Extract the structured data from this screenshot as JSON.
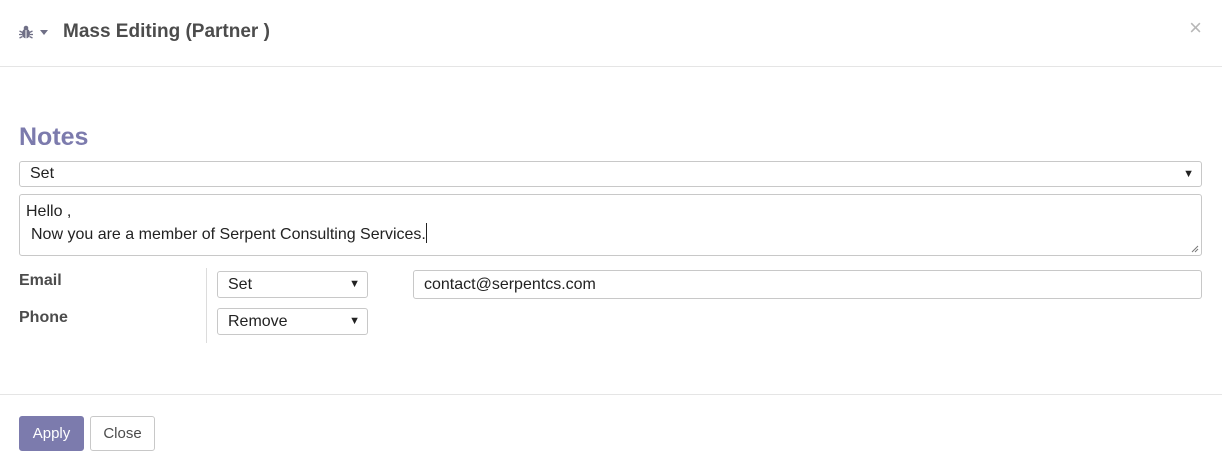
{
  "header": {
    "title": "Mass Editing (Partner )",
    "close_glyph": "×",
    "debug_icon": "bug-icon"
  },
  "notes": {
    "section_title": "Notes",
    "action": "Set",
    "text_line1": "Hello ,",
    "text_line2": "Now you are a member of Serpent Consulting Services."
  },
  "fields": {
    "email": {
      "label": "Email",
      "action": "Set",
      "value": "contact@serpentcs.com"
    },
    "phone": {
      "label": "Phone",
      "action": "Remove"
    }
  },
  "footer": {
    "apply_label": "Apply",
    "close_label": "Close"
  },
  "colors": {
    "accent": "#7c7bad",
    "text": "#4c4c4c",
    "border": "#c8c8c8"
  }
}
